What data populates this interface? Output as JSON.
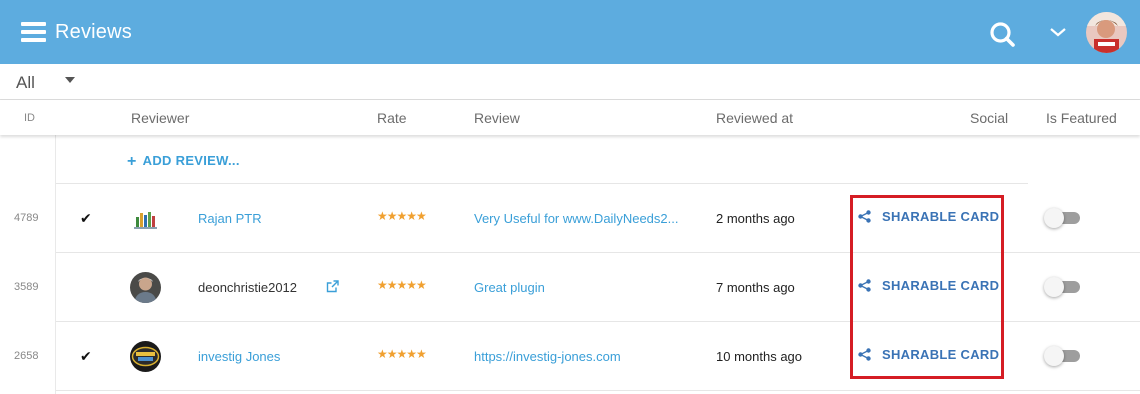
{
  "app": {
    "title": "Reviews"
  },
  "header": {
    "icons": [
      "menu-icon",
      "search-icon",
      "chevron-down-icon"
    ],
    "bar_color": "#5dacdf"
  },
  "filter": {
    "value": "All"
  },
  "columns": {
    "id": "ID",
    "reviewer": "Reviewer",
    "rate": "Rate",
    "review": "Review",
    "reviewed_at": "Reviewed at",
    "social": "Social",
    "featured": "Is Featured"
  },
  "add_review": {
    "label": "ADD REVIEW..."
  },
  "rows": [
    {
      "id": "4789",
      "checked": "✔",
      "reviewer": "Rajan PTR",
      "stars": "★★★★★",
      "review": "Very Useful for www.DailyNeeds2...",
      "reviewed_at": "2 months ago",
      "social": "SHARABLE CARD",
      "featured": false
    },
    {
      "id": "3589",
      "checked": "",
      "reviewer": "deonchristie2012",
      "stars": "★★★★★",
      "review": "Great plugin",
      "reviewed_at": "7 months ago",
      "social": "SHARABLE CARD",
      "featured": false
    },
    {
      "id": "2658",
      "checked": "✔",
      "reviewer": "investig Jones",
      "stars": "★★★★★",
      "review": "https://investig-jones.com",
      "reviewed_at": "10 months ago",
      "social": "SHARABLE CARD",
      "featured": false
    }
  ],
  "colors": {
    "accent": "#3a9fd8",
    "share": "#3a73b5",
    "stars": "#f0a030",
    "highlight": "#d51d24"
  }
}
